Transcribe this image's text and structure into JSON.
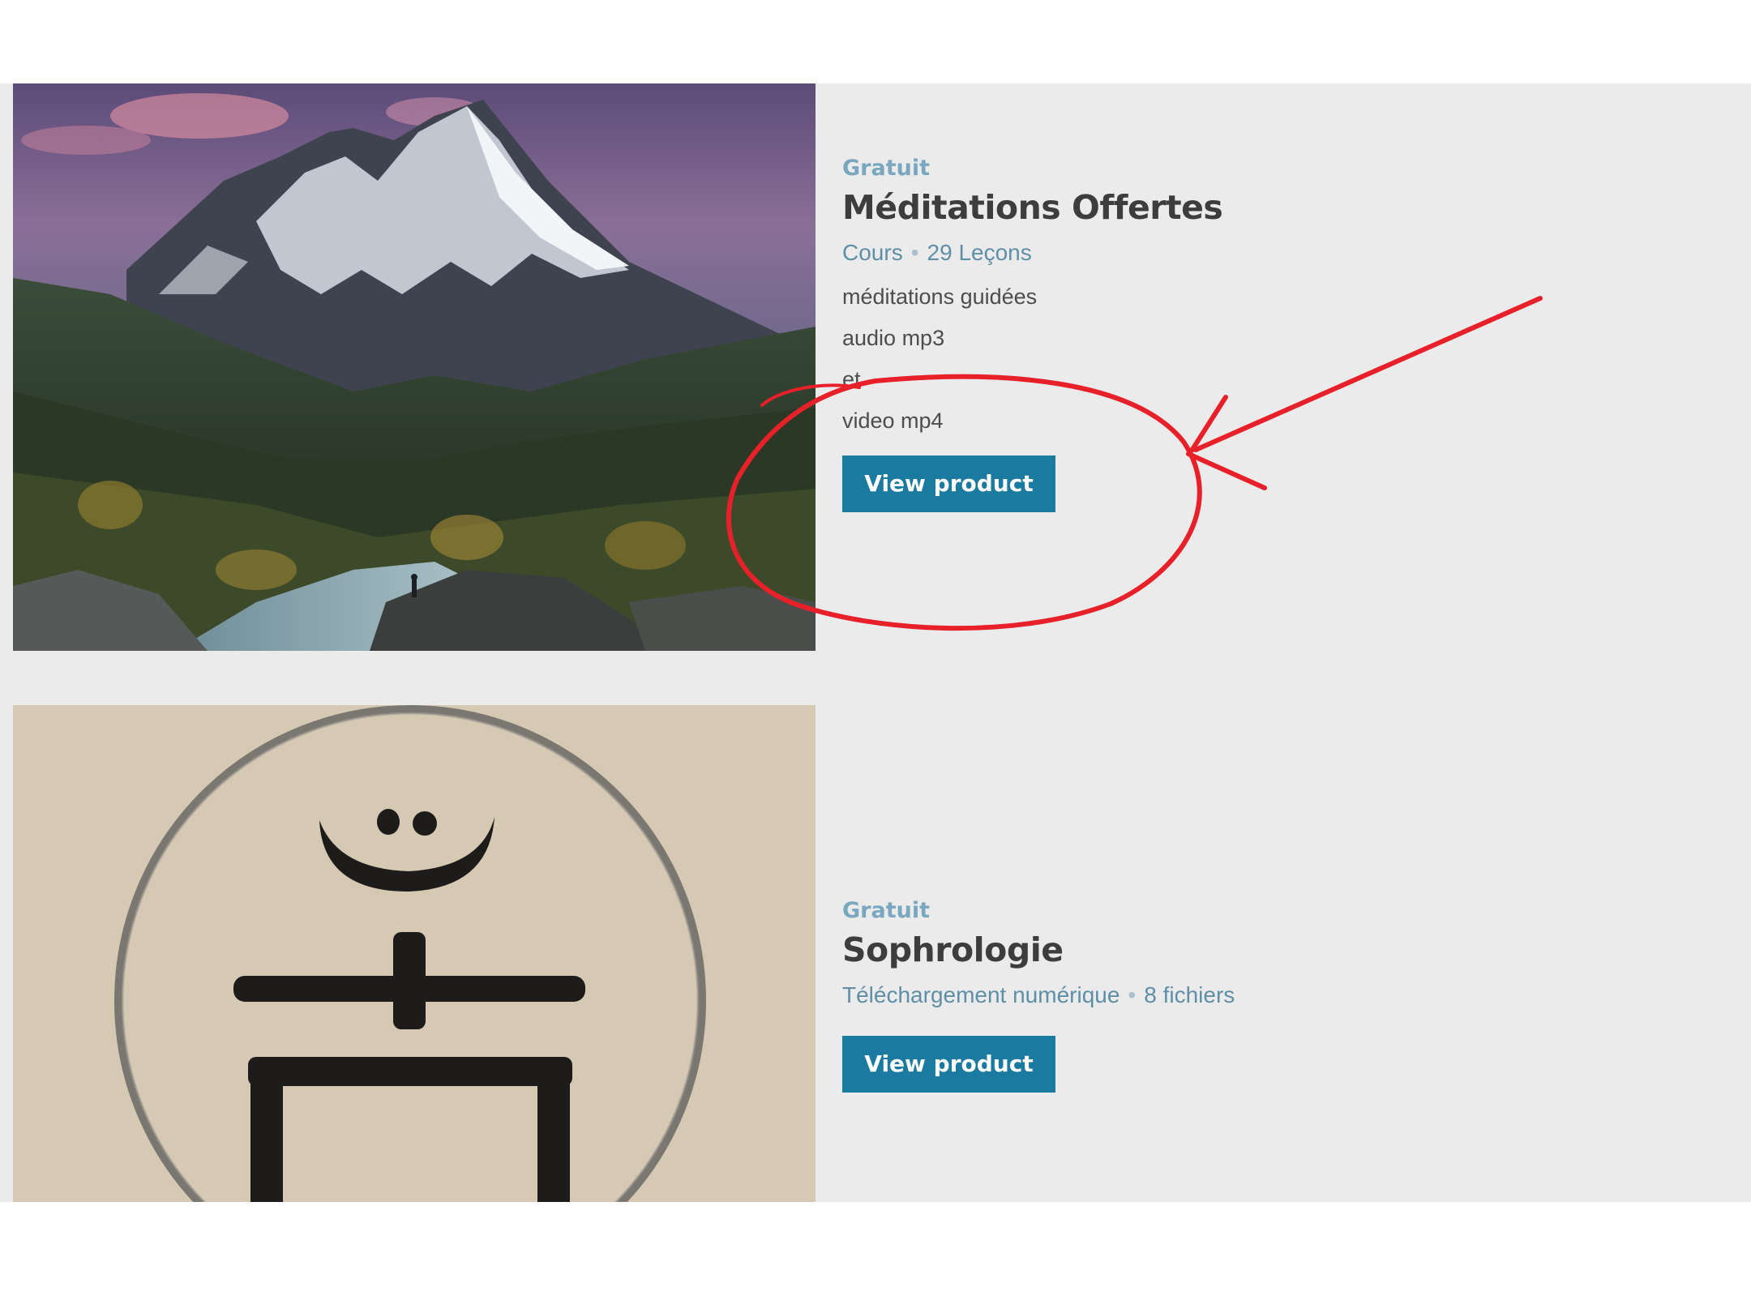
{
  "products": [
    {
      "price": "Gratuit",
      "title": "Méditations Offertes",
      "type": "Cours",
      "count": "29 Leçons",
      "description": [
        "méditations guidées",
        "audio mp3",
        "et",
        "video mp4"
      ],
      "button": "View product"
    },
    {
      "price": "Gratuit",
      "title": "Sophrologie",
      "type": "Téléchargement numérique",
      "count": "8 fichiers",
      "button": "View product"
    }
  ],
  "colors": {
    "accent": "#1b7aa0",
    "price": "#79a7bf",
    "annotation": "#e8202a",
    "panel": "#ebebeb"
  }
}
